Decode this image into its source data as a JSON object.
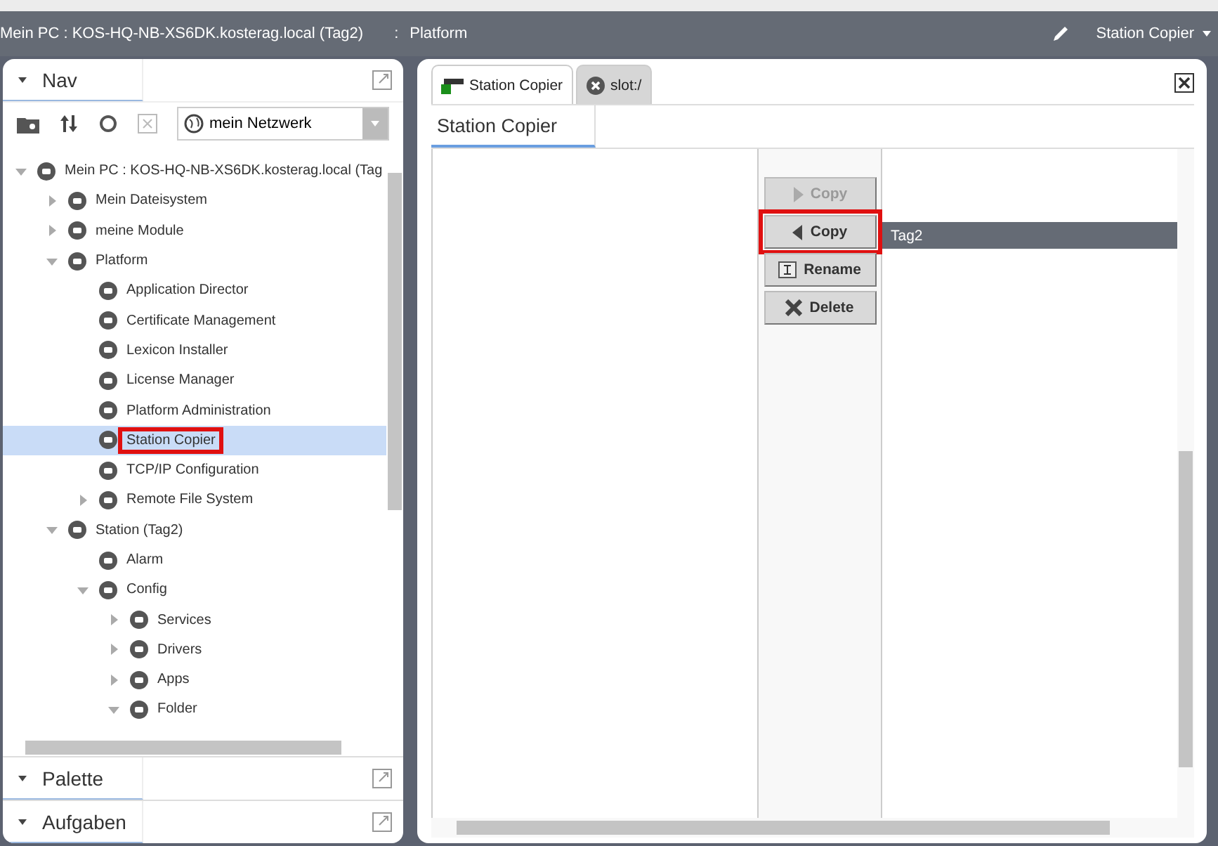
{
  "top_bar": {
    "path": "Mein PC : KOS-HQ-NB-XS6DK.kosterag.local (Tag2)",
    "separator": ":",
    "location": "Platform",
    "view_menu": "Station Copier"
  },
  "sidebar": {
    "nav": {
      "title": "Nav",
      "expanded": true,
      "dropdown": "mein Netzwerk",
      "tree": [
        {
          "label": "Mein PC : KOS-HQ-NB-XS6DK.kosterag.local (Tag",
          "expanded": true,
          "selected": false,
          "annotated": false,
          "children": [
            {
              "label": "Mein Dateisystem",
              "expanded": false,
              "selected": false,
              "annotated": false
            },
            {
              "label": "meine Module",
              "expanded": false,
              "selected": false,
              "annotated": false
            },
            {
              "label": "Platform",
              "expanded": true,
              "selected": false,
              "annotated": false,
              "children": [
                {
                  "label": "Application Director",
                  "selected": false,
                  "annotated": false
                },
                {
                  "label": "Certificate Management",
                  "selected": false,
                  "annotated": false
                },
                {
                  "label": "Lexicon Installer",
                  "selected": false,
                  "annotated": false
                },
                {
                  "label": "License Manager",
                  "selected": false,
                  "annotated": false
                },
                {
                  "label": "Platform Administration",
                  "selected": false,
                  "annotated": false
                },
                {
                  "label": "Station Copier",
                  "selected": true,
                  "annotated": true
                },
                {
                  "label": "TCP/IP Configuration",
                  "selected": false,
                  "annotated": false
                },
                {
                  "label": "Remote File System",
                  "expanded": false,
                  "selected": false,
                  "annotated": false
                }
              ]
            },
            {
              "label": "Station (Tag2)",
              "expanded": true,
              "selected": false,
              "annotated": false,
              "children": [
                {
                  "label": "Alarm",
                  "selected": false,
                  "annotated": false
                },
                {
                  "label": "Config",
                  "expanded": true,
                  "selected": false,
                  "annotated": false,
                  "children": [
                    {
                      "label": "Services",
                      "expanded": false,
                      "selected": false,
                      "annotated": false
                    },
                    {
                      "label": "Drivers",
                      "expanded": false,
                      "selected": false,
                      "annotated": false
                    },
                    {
                      "label": "Apps",
                      "expanded": false,
                      "selected": false,
                      "annotated": false
                    },
                    {
                      "label": "Folder",
                      "expanded": true,
                      "selected": false,
                      "annotated": false
                    }
                  ]
                }
              ]
            }
          ]
        }
      ]
    },
    "panels": [
      {
        "title": "Palette",
        "expanded": true
      },
      {
        "title": "Aufgaben",
        "expanded": true
      }
    ]
  },
  "main": {
    "tabs": [
      {
        "label": "Station Copier",
        "selected": true,
        "kind": "station"
      },
      {
        "label": "slot:/",
        "selected": false,
        "kind": "error"
      }
    ],
    "view_title": "Station Copier",
    "buttons": [
      {
        "label": "Copy",
        "kind": "copy-right",
        "disabled": true,
        "annotated": false
      },
      {
        "label": "Copy",
        "kind": "copy-left",
        "disabled": false,
        "annotated": true
      },
      {
        "label": "Rename",
        "kind": "rename",
        "disabled": false,
        "annotated": false
      },
      {
        "label": "Delete",
        "kind": "delete",
        "disabled": false,
        "annotated": false
      }
    ],
    "stations": [
      {
        "label": "Tag2",
        "selected": true
      }
    ]
  }
}
